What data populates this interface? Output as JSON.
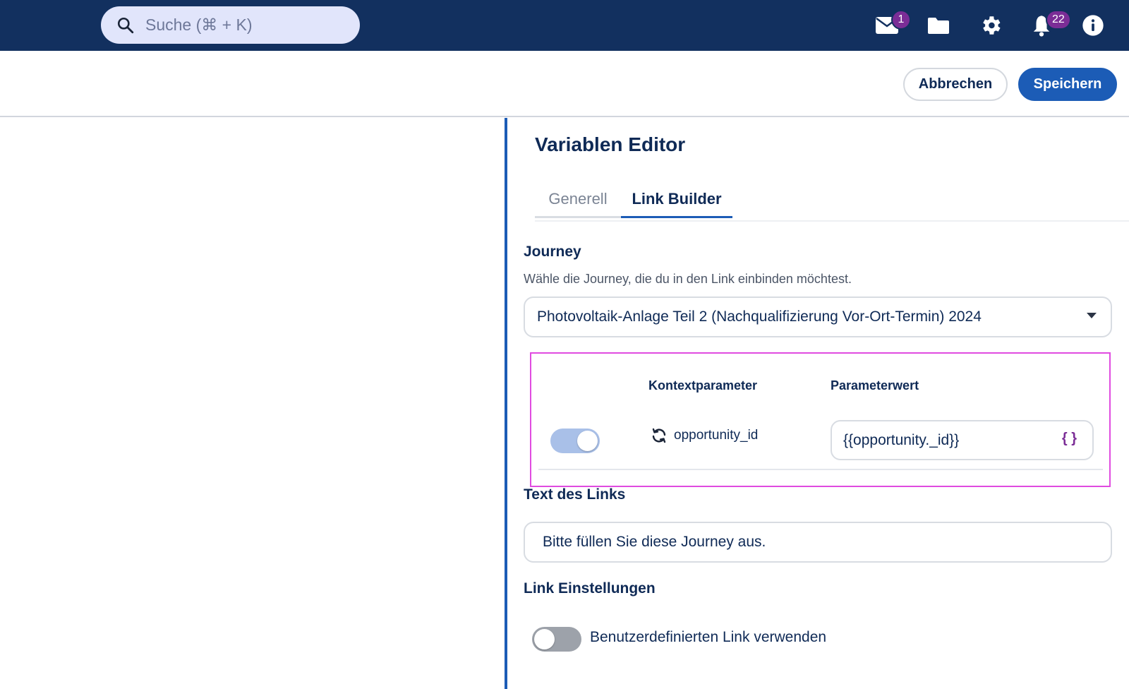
{
  "header": {
    "search_placeholder": "Suche (⌘ + K)",
    "mail_badge": "1",
    "notifications_badge": "22",
    "colors": {
      "bar": "#12305f",
      "badge": "#7b2d96",
      "search_bg": "#e1e5fb"
    }
  },
  "actions": {
    "cancel_label": "Abbrechen",
    "save_label": "Speichern",
    "save_color": "#1c5cb6"
  },
  "editor": {
    "title": "Variablen Editor",
    "tabs": [
      {
        "label": "Generell",
        "active": false
      },
      {
        "label": "Link Builder",
        "active": true
      }
    ],
    "journey": {
      "label": "Journey",
      "hint": "Wähle die Journey, die du in den Link einbinden möchtest.",
      "selected": "Photovoltaik-Anlage Teil 2 (Nachqualifizierung Vor-Ort-Termin) 2024"
    },
    "parameters": {
      "col_context": "Kontextparameter",
      "col_value": "Parameterwert",
      "rows": [
        {
          "enabled": true,
          "name": "opportunity_id",
          "value": "{{opportunity._id}}",
          "icon": "refresh-icon"
        }
      ]
    },
    "link_text": {
      "label": "Text des Links",
      "value": "Bitte füllen Sie diese Journey aus."
    },
    "link_settings": {
      "label": "Link Einstellungen",
      "custom_link_label": "Benutzerdefinierten Link verwenden",
      "custom_link_enabled": false
    }
  }
}
